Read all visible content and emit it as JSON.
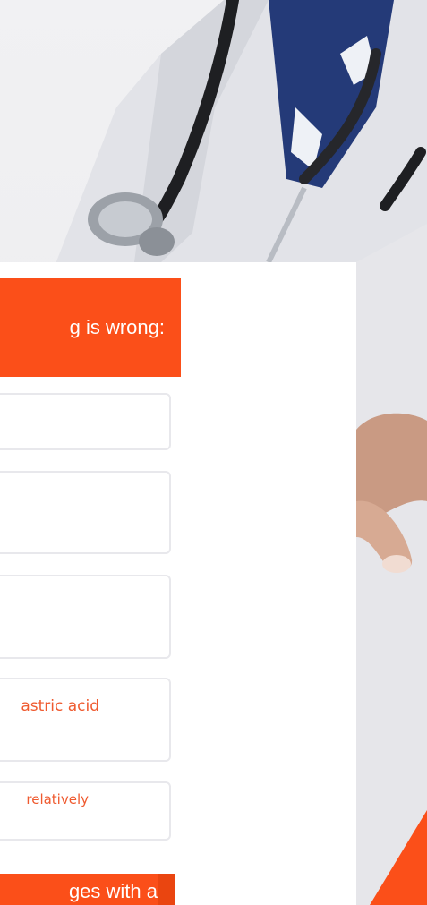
{
  "question": {
    "text_fragment": "g is wrong:"
  },
  "options": [
    {
      "text": ""
    },
    {
      "text": ""
    },
    {
      "text": ""
    },
    {
      "text": "astric acid"
    },
    {
      "text": "relatively"
    }
  ],
  "next_question": {
    "text_fragment": "ges with a"
  },
  "colors": {
    "accent": "#fb4f19",
    "option_text": "#ef5a2f",
    "option_border": "#e8e8ec"
  }
}
